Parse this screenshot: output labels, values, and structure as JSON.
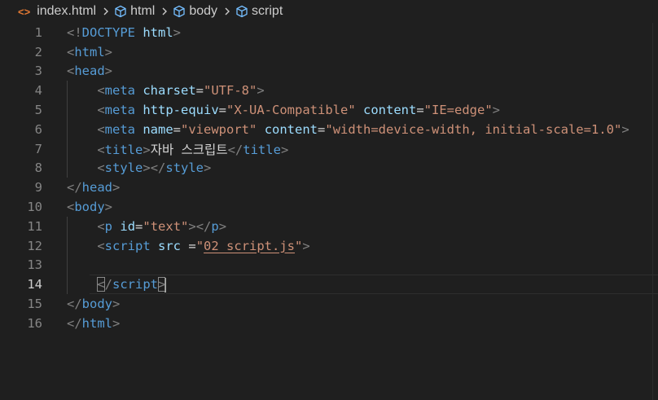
{
  "breadcrumb": {
    "file_icon": "<>",
    "file": "index.html",
    "items": [
      "html",
      "body",
      "script"
    ]
  },
  "lines": [
    {
      "n": "1",
      "tokens": [
        [
          "t",
          "<!"
        ],
        [
          "n",
          "DOCTYPE"
        ],
        [
          "x",
          " "
        ],
        [
          "a",
          "html"
        ],
        [
          "t",
          ">"
        ]
      ]
    },
    {
      "n": "2",
      "tokens": [
        [
          "t",
          "<"
        ],
        [
          "n",
          "html"
        ],
        [
          "t",
          ">"
        ]
      ]
    },
    {
      "n": "3",
      "tokens": [
        [
          "t",
          "<"
        ],
        [
          "n",
          "head"
        ],
        [
          "t",
          ">"
        ]
      ]
    },
    {
      "n": "4",
      "indent": "    ",
      "tokens": [
        [
          "t",
          "<"
        ],
        [
          "n",
          "meta"
        ],
        [
          "x",
          " "
        ],
        [
          "a",
          "charset"
        ],
        [
          "x",
          "="
        ],
        [
          "s",
          "\"UTF-8\""
        ],
        [
          "t",
          ">"
        ]
      ]
    },
    {
      "n": "5",
      "indent": "    ",
      "tokens": [
        [
          "t",
          "<"
        ],
        [
          "n",
          "meta"
        ],
        [
          "x",
          " "
        ],
        [
          "a",
          "http-equiv"
        ],
        [
          "x",
          "="
        ],
        [
          "s",
          "\"X-UA-Compatible\""
        ],
        [
          "x",
          " "
        ],
        [
          "a",
          "content"
        ],
        [
          "x",
          "="
        ],
        [
          "s",
          "\"IE=edge\""
        ],
        [
          "t",
          ">"
        ]
      ]
    },
    {
      "n": "6",
      "indent": "    ",
      "tokens": [
        [
          "t",
          "<"
        ],
        [
          "n",
          "meta"
        ],
        [
          "x",
          " "
        ],
        [
          "a",
          "name"
        ],
        [
          "x",
          "="
        ],
        [
          "s",
          "\"viewport\""
        ],
        [
          "x",
          " "
        ],
        [
          "a",
          "content"
        ],
        [
          "x",
          "="
        ],
        [
          "s",
          "\"width=device-width, initial-scale=1.0\""
        ],
        [
          "t",
          ">"
        ]
      ]
    },
    {
      "n": "7",
      "indent": "    ",
      "tokens": [
        [
          "t",
          "<"
        ],
        [
          "n",
          "title"
        ],
        [
          "t",
          ">"
        ],
        [
          "x",
          "자바 스크립트"
        ],
        [
          "t",
          "</"
        ],
        [
          "n",
          "title"
        ],
        [
          "t",
          ">"
        ]
      ]
    },
    {
      "n": "8",
      "indent": "    ",
      "tokens": [
        [
          "t",
          "<"
        ],
        [
          "n",
          "style"
        ],
        [
          "t",
          ">"
        ],
        [
          "t",
          "</"
        ],
        [
          "n",
          "style"
        ],
        [
          "t",
          ">"
        ]
      ]
    },
    {
      "n": "9",
      "tokens": [
        [
          "t",
          "</"
        ],
        [
          "n",
          "head"
        ],
        [
          "t",
          ">"
        ]
      ]
    },
    {
      "n": "10",
      "tokens": [
        [
          "t",
          "<"
        ],
        [
          "n",
          "body"
        ],
        [
          "t",
          ">"
        ]
      ]
    },
    {
      "n": "11",
      "indent": "    ",
      "tokens": [
        [
          "t",
          "<"
        ],
        [
          "n",
          "p"
        ],
        [
          "x",
          " "
        ],
        [
          "a",
          "id"
        ],
        [
          "x",
          "="
        ],
        [
          "s",
          "\"text\""
        ],
        [
          "t",
          "></"
        ],
        [
          "n",
          "p"
        ],
        [
          "t",
          ">"
        ]
      ]
    },
    {
      "n": "12",
      "indent": "    ",
      "tokens": [
        [
          "t",
          "<"
        ],
        [
          "n",
          "script"
        ],
        [
          "x",
          " "
        ],
        [
          "a",
          "src"
        ],
        [
          "x",
          " ="
        ],
        [
          "s",
          "\""
        ],
        [
          "sl",
          "02_script.js"
        ],
        [
          "s",
          "\""
        ],
        [
          "t",
          ">"
        ]
      ]
    },
    {
      "n": "13",
      "tokens": []
    },
    {
      "n": "14",
      "current": true,
      "indent": "    ",
      "tokens": [
        [
          "tb",
          "<"
        ],
        [
          "t",
          "/"
        ],
        [
          "n",
          "script"
        ],
        [
          "tb",
          ">"
        ]
      ]
    },
    {
      "n": "15",
      "tokens": [
        [
          "t",
          "</"
        ],
        [
          "n",
          "body"
        ],
        [
          "t",
          ">"
        ]
      ]
    },
    {
      "n": "16",
      "tokens": [
        [
          "t",
          "</"
        ],
        [
          "n",
          "html"
        ],
        [
          "t",
          ">"
        ]
      ]
    }
  ],
  "cursor": {
    "line": "14"
  }
}
